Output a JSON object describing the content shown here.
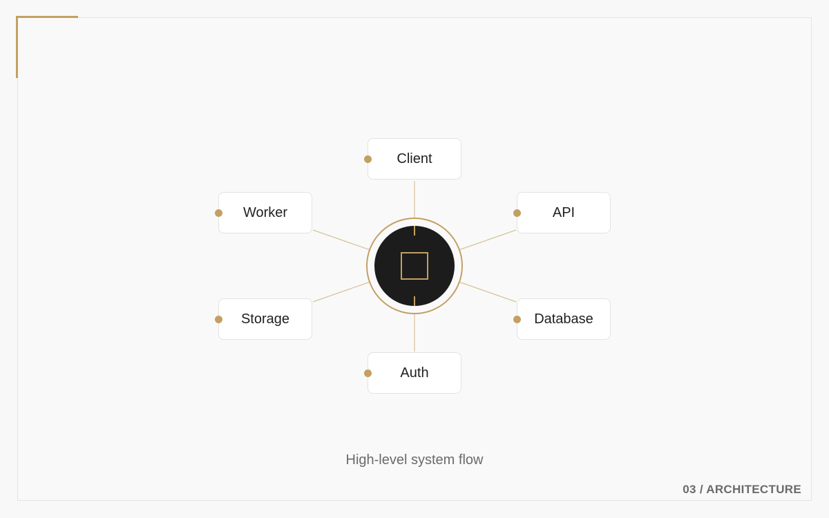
{
  "diagram": {
    "hub": {
      "icon": "square-outline-icon"
    },
    "nodes": [
      {
        "id": "client",
        "label": "Client"
      },
      {
        "id": "api",
        "label": "API"
      },
      {
        "id": "database",
        "label": "Database"
      },
      {
        "id": "auth",
        "label": "Auth"
      },
      {
        "id": "storage",
        "label": "Storage"
      },
      {
        "id": "worker",
        "label": "Worker"
      }
    ],
    "edges": [
      {
        "from": "hub",
        "to": "client"
      },
      {
        "from": "hub",
        "to": "api"
      },
      {
        "from": "hub",
        "to": "database"
      },
      {
        "from": "hub",
        "to": "auth"
      },
      {
        "from": "hub",
        "to": "storage"
      },
      {
        "from": "hub",
        "to": "worker"
      }
    ]
  },
  "caption": "High-level system flow",
  "section": {
    "number": "03",
    "separator": "/",
    "title": "ARCHITECTURE"
  },
  "colors": {
    "accent": "#c3a062",
    "hub": "#1c1c1c",
    "node_border": "#e2e2e2",
    "background": "#f9f9f9",
    "text": "#1f1f1f",
    "muted_text": "#6a6a6a"
  }
}
